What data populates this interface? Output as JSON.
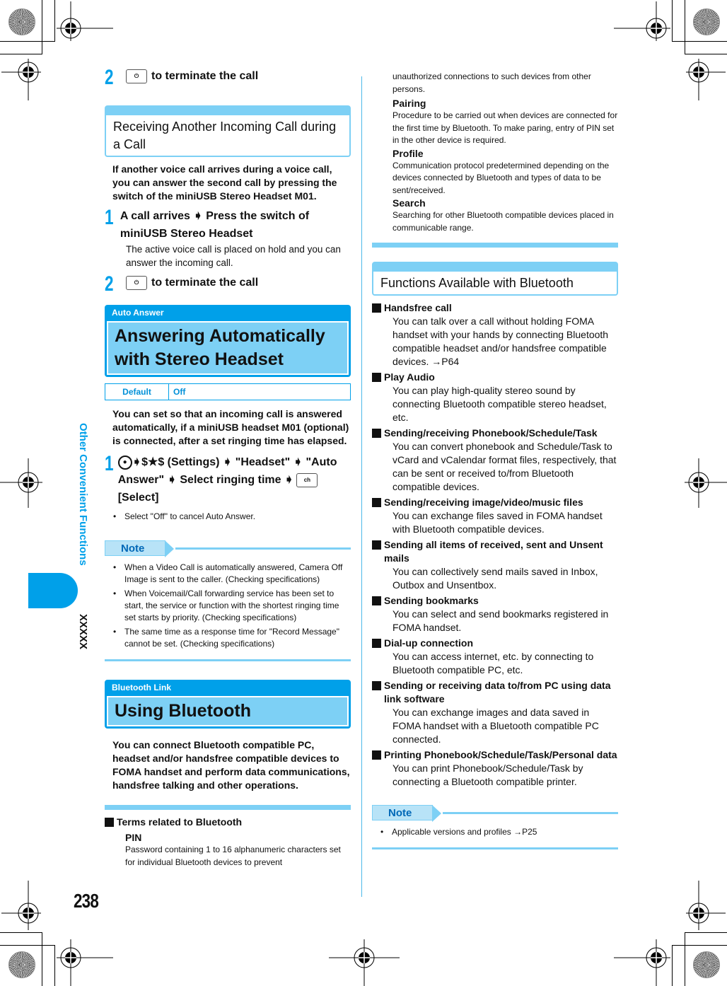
{
  "page": {
    "number": "238",
    "side_label": "Other Convenient Functions",
    "side_tab_label": "XXXXX"
  },
  "left": {
    "step_top": {
      "num": "2",
      "key_icon": "power-end-key-icon",
      "text": "to terminate the call"
    },
    "section1": {
      "title": "Receiving Another Incoming Call during a Call",
      "intro": "If another voice call arrives during a voice call, you can answer the second call by pressing the switch of the miniUSB Stereo Headset M01.",
      "steps": [
        {
          "num": "1",
          "text": "A call arrives ➧ Press the switch of miniUSB Stereo Headset",
          "desc": "The active voice call is placed on hold and you can answer the incoming call."
        },
        {
          "num": "2",
          "key_icon": "power-end-key-icon",
          "text": "to terminate the call"
        }
      ]
    },
    "section2": {
      "tag": "Auto Answer",
      "title": "Answering Automatically with Stereo Headset",
      "default_label": "Default",
      "default_value": "Off",
      "intro": "You can set so that an incoming call is answered automatically, if a miniUSB headset M01 (optional) is connected, after a set ringing time has elapsed.",
      "step": {
        "num": "1",
        "text": "➧$★$ (Settings) ➧ \"Headset\" ➧ \"Auto Answer\" ➧ Select ringing time ➧",
        "select_label": "[Select]",
        "bullet": "Select \"Off\" to cancel Auto Answer."
      },
      "note_label": "Note",
      "notes": [
        "When a Video Call is automatically answered, Camera Off Image is sent to the caller. (Checking specifications)",
        "When Voicemail/Call forwarding service has been set to start, the service or function with the shortest ringing time set starts by priority. (Checking specifications)",
        "The same time as a response time for \"Record Message\" cannot be set. (Checking specifications)"
      ]
    },
    "section3": {
      "tag": "Bluetooth Link",
      "title": "Using Bluetooth",
      "intro": "You can connect Bluetooth compatible PC, headset and/or handsfree compatible devices to FOMA handset and perform data communications, handsfree talking and other operations.",
      "terms_heading": "Terms related to Bluetooth",
      "pin_term": "PIN",
      "pin_desc": "Password containing 1 to 16 alphanumeric characters set for individual Bluetooth devices to prevent"
    }
  },
  "right": {
    "pin_desc_cont": "unauthorized connections to such devices from other persons.",
    "terms": [
      {
        "term": "Pairing",
        "desc": "Procedure to be carried out when devices are connected for the first time by Bluetooth. To make paring, entry of PIN set in the other device is required."
      },
      {
        "term": "Profile",
        "desc": "Communication protocol predetermined depending on the devices connected by Bluetooth and types of data to be sent/received."
      },
      {
        "term": "Search",
        "desc": "Searching for other Bluetooth compatible devices placed in communicable range."
      }
    ],
    "functions_title": "Functions Available with Bluetooth",
    "functions": [
      {
        "h": "Handsfree call",
        "b": "You can talk over a call without holding FOMA handset with your hands by connecting Bluetooth compatible headset and/or handsfree compatible devices. →P64"
      },
      {
        "h": "Play Audio",
        "b": "You can play high-quality stereo sound by connecting Bluetooth compatible stereo headset, etc."
      },
      {
        "h": "Sending/receiving Phonebook/Schedule/Task",
        "b": "You can convert phonebook and Schedule/Task to vCard and vCalendar format files, respectively, that can be sent or received to/from Bluetooth compatible devices."
      },
      {
        "h": "Sending/receiving image/video/music files",
        "b": "You can exchange files saved in FOMA handset with Bluetooth compatible devices."
      },
      {
        "h": "Sending all items of received, sent and Unsent mails",
        "b": "You can collectively send mails saved in Inbox, Outbox and Unsentbox."
      },
      {
        "h": "Sending bookmarks",
        "b": "You can select and send bookmarks registered in FOMA handset."
      },
      {
        "h": "Dial-up connection",
        "b": "You can access internet, etc. by connecting to Bluetooth compatible PC, etc."
      },
      {
        "h": "Sending or receiving data to/from PC using data link software",
        "b": "You can exchange images and data saved in FOMA handset with a Bluetooth compatible PC connected."
      },
      {
        "h": "Printing Phonebook/Schedule/Task/Personal data",
        "b": "You can print Phonebook/Schedule/Task by connecting a Bluetooth compatible printer."
      }
    ],
    "note_label": "Note",
    "notes": [
      "Applicable versions and profiles →P25"
    ]
  }
}
